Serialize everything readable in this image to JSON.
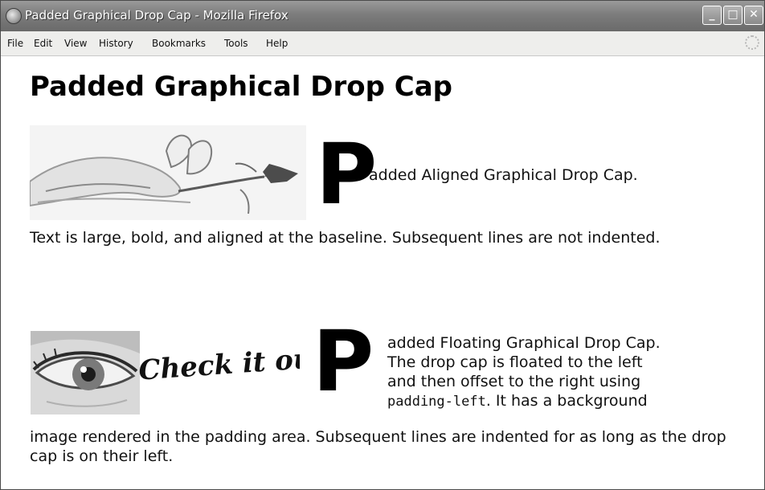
{
  "window": {
    "title": "Padded Graphical Drop Cap - Mozilla Firefox",
    "buttons": {
      "minimize": "_",
      "maximize": "□",
      "close": "✕"
    }
  },
  "menubar": {
    "items": [
      {
        "label": "File",
        "key": "F"
      },
      {
        "label": "Edit",
        "key": "E"
      },
      {
        "label": "View",
        "key": "V"
      },
      {
        "label": "History",
        "key": "s"
      },
      {
        "label": "Bookmarks",
        "key": "B"
      },
      {
        "label": "Tools",
        "key": "T"
      },
      {
        "label": "Help",
        "key": "H"
      }
    ]
  },
  "page": {
    "heading": "Padded Graphical Drop Cap",
    "example1": {
      "drop_cap": "P",
      "line1": "added Aligned Graphical Drop Cap.",
      "paragraph": "Text is large, bold, and aligned at the baseline. Subsequent lines are not indented."
    },
    "example2": {
      "drop_cap": "P",
      "image_text": "Check it out!",
      "float_line1": "added Floating Graphical Drop Cap.",
      "float_line2": "The drop cap is floated to the left",
      "float_line3": "and then offset to the right using",
      "float_code": "padding-left",
      "float_line4_rest": ". It has a background",
      "continuation": "image rendered in the padding area. Subsequent lines are indented for as long as the drop cap is on their left."
    }
  }
}
